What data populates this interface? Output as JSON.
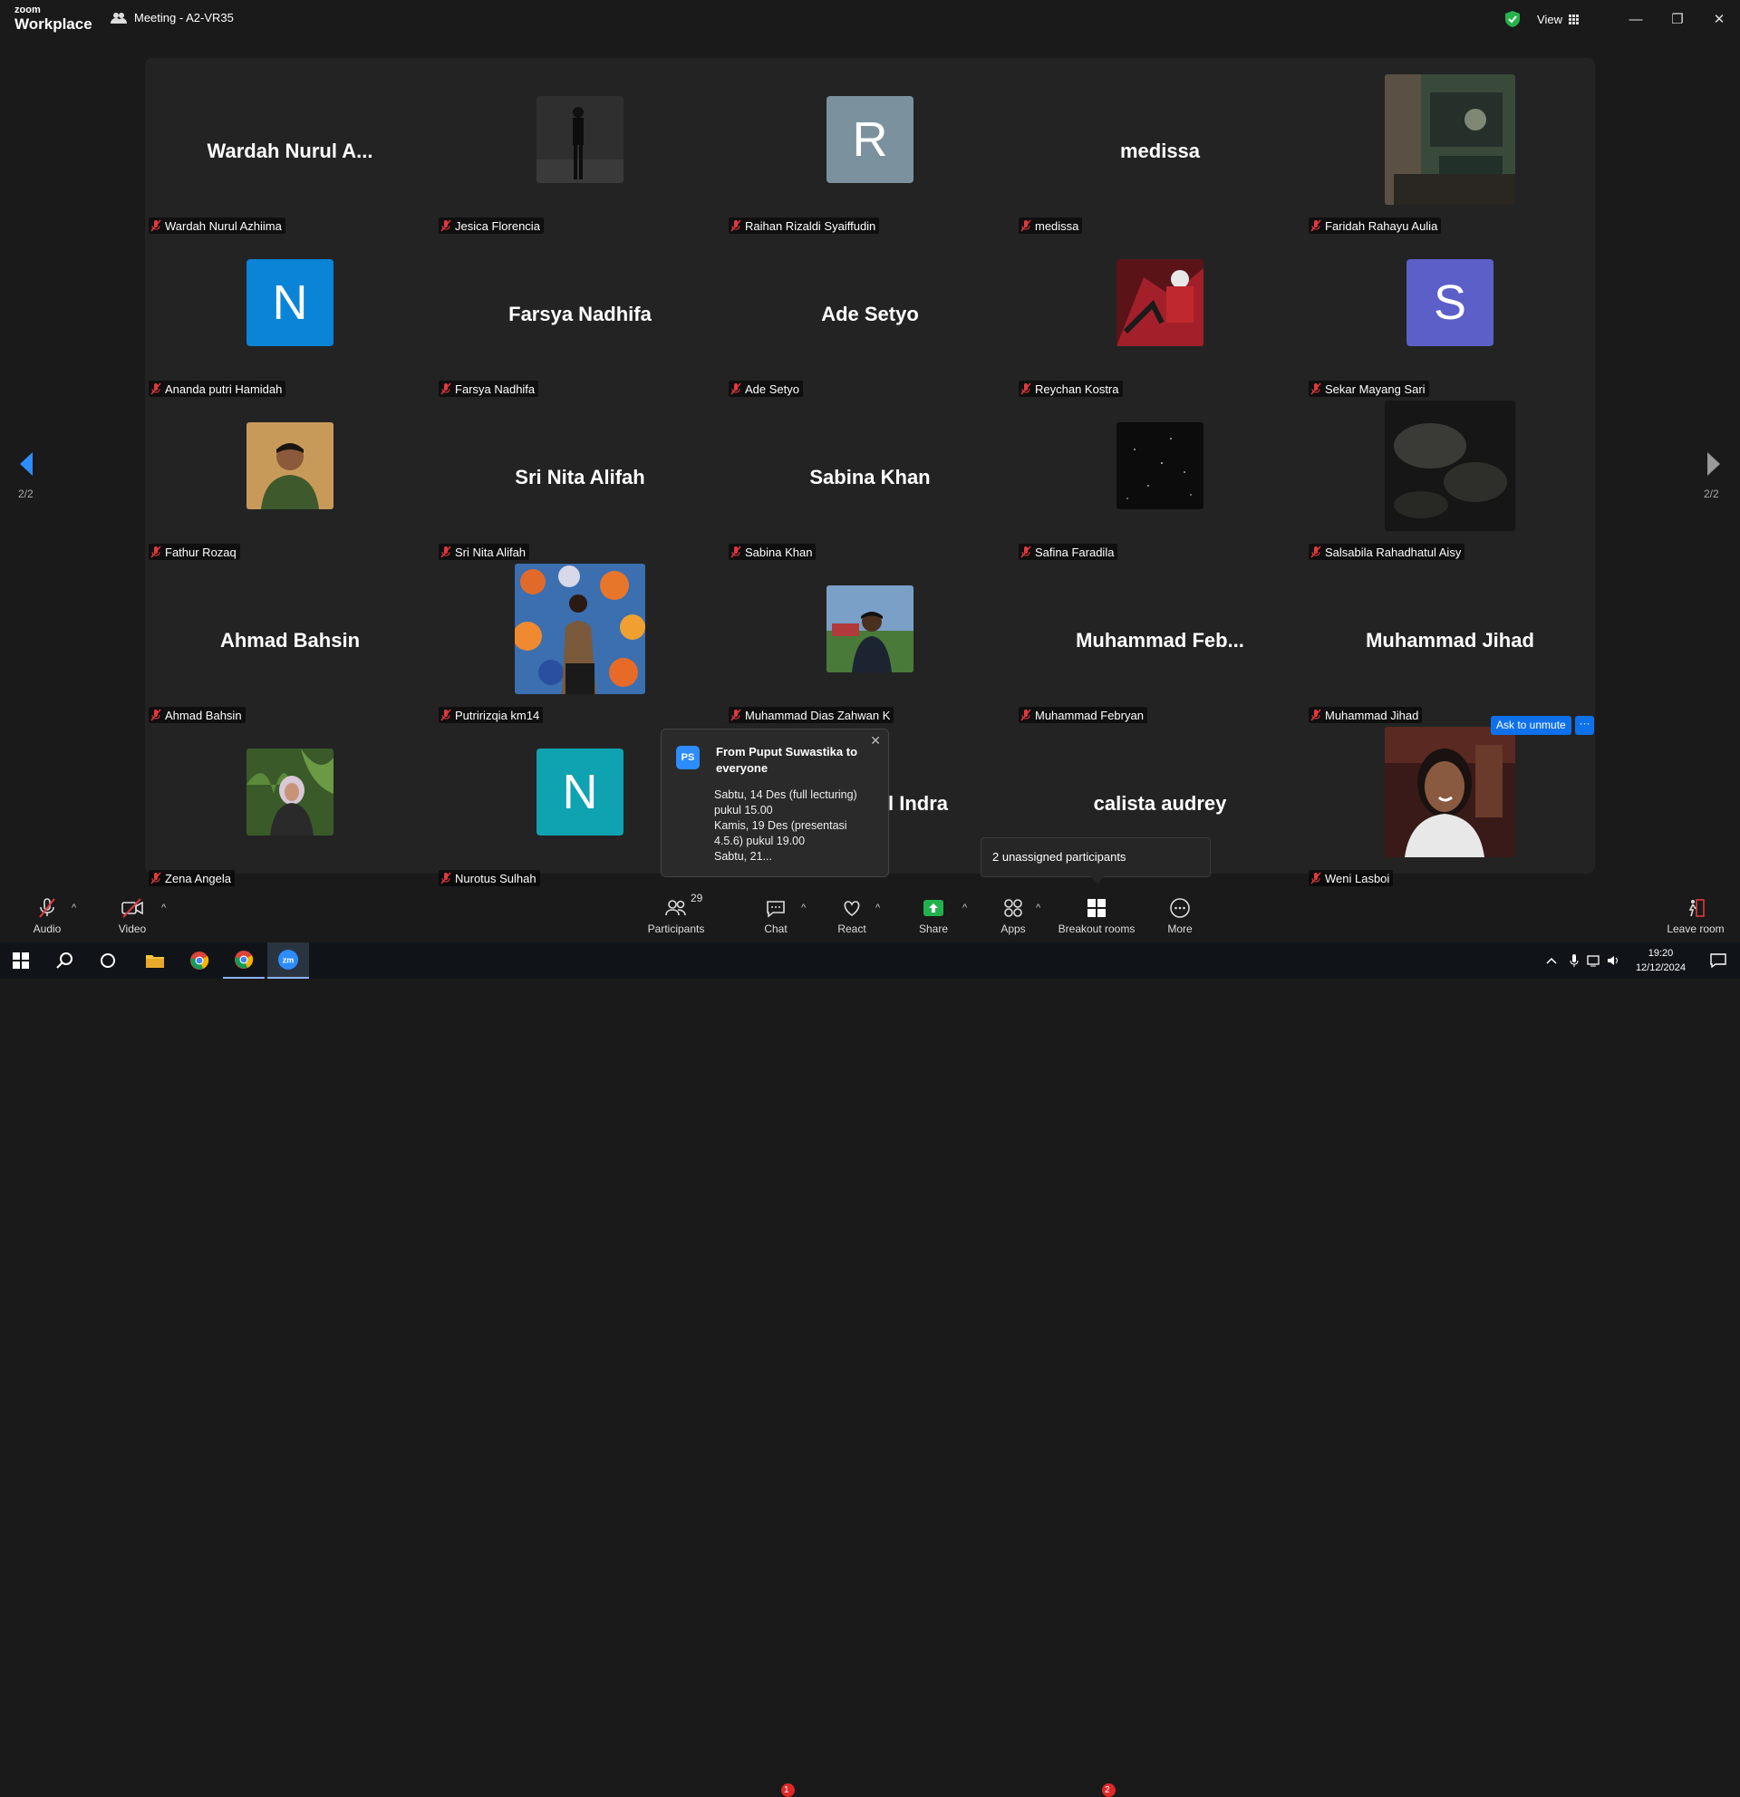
{
  "titlebar": {
    "logo_top": "zoom",
    "logo_bottom": "Workplace",
    "meeting_title": "Meeting - A2-VR35",
    "view_label": "View"
  },
  "pager": {
    "left": "2/2",
    "right": "2/2"
  },
  "tiles": [
    {
      "display": "Wardah Nurul A...",
      "label": "Wardah Nurul Azhiima"
    },
    {
      "label": "Jesica Florencia"
    },
    {
      "initial": "R",
      "label": "Raihan Rizaldi Syaiffudin"
    },
    {
      "display": "medissa",
      "label": "medissa"
    },
    {
      "label": "Faridah Rahayu Aulia"
    },
    {
      "initial": "N",
      "label": "Ananda putri Hamidah"
    },
    {
      "display": "Farsya Nadhifa",
      "label": "Farsya Nadhifa"
    },
    {
      "display": "Ade Setyo",
      "label": "Ade Setyo"
    },
    {
      "label": "Reychan Kostra"
    },
    {
      "initial": "S",
      "label": "Sekar Mayang Sari"
    },
    {
      "label": "Fathur Rozaq"
    },
    {
      "display": "Sri Nita Alifah",
      "label": "Sri Nita Alifah"
    },
    {
      "display": "Sabina Khan",
      "label": "Sabina Khan"
    },
    {
      "label": "Safina Faradila"
    },
    {
      "label": "Salsabila Rahadhatul Aisy"
    },
    {
      "display": "Ahmad Bahsin",
      "label": "Ahmad Bahsin"
    },
    {
      "label": "Putririzqia km14"
    },
    {
      "label": "Muhammad Dias Zahwan K"
    },
    {
      "display": "Muhammad  Feb...",
      "label": "Muhammad Febryan"
    },
    {
      "display": "Muhammad Jihad",
      "label": "Muhammad Jihad"
    },
    {
      "label": "Zena Angela"
    },
    {
      "initial": "N",
      "label": "Nurotus Sulhah"
    },
    {
      "display": "l Indra"
    },
    {
      "display": "calista audrey"
    },
    {
      "label": "Weni Lasboi"
    }
  ],
  "colors": {
    "avatar_R": "#7b929e",
    "avatar_N_blue": "#0a84d6",
    "avatar_S": "#5b5fc7",
    "avatar_N_teal": "#0fa3b1",
    "accent": "#0e71eb"
  },
  "chat_popup": {
    "avatar": "PS",
    "header": "From Puput Suwastika to everyone",
    "line1": "Sabtu, 14 Des (full lecturing)",
    "line2": "pukul 15.00",
    "line3": "Kamis, 19 Des (presentasi",
    "line4": "4.5.6) pukul 19.00",
    "line5": "Sabtu, 21..."
  },
  "unassigned": "2 unassigned participants",
  "ask_unmute": "Ask to unmute",
  "more_small": "···",
  "toolbar": {
    "audio": "Audio",
    "video": "Video",
    "participants": "Participants",
    "participants_count": "29",
    "chat": "Chat",
    "chat_badge": "1",
    "react": "React",
    "share": "Share",
    "apps": "Apps",
    "breakout": "Breakout rooms",
    "breakout_badge": "2",
    "more": "More",
    "leave": "Leave room"
  },
  "taskbar": {
    "time": "19:20",
    "date": "12/12/2024"
  }
}
